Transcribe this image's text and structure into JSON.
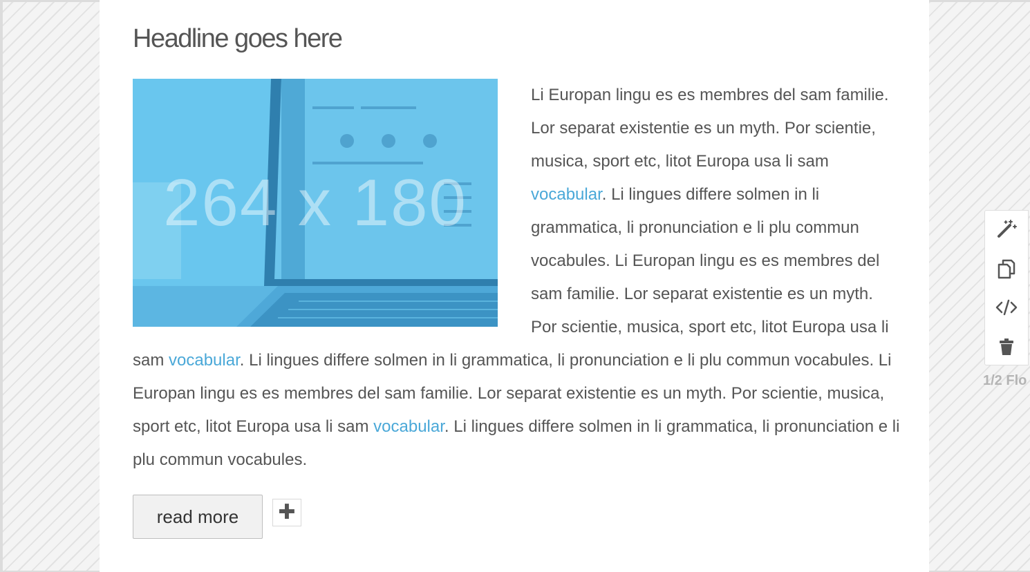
{
  "article": {
    "headline": "Headline goes here",
    "image": {
      "size_label": "264 x 180",
      "color": "#69c6ee"
    },
    "body": [
      {
        "text": "Li Europan lingu es es membres del sam familie. Lor separat existentie es un myth. Por scientie, musica, sport etc, litot Europa usa li sam "
      },
      {
        "link": "vocabular"
      },
      {
        "text": ". Li lingues differe solmen in li grammatica, li pronunciation e li plu commun vocabules. Li Europan lingu es es membres del sam familie. Lor separat existentie es un myth. Por scientie, musica, sport etc, litot Europa usa li sam "
      },
      {
        "link": "vocabular"
      },
      {
        "text": ". Li lingues differe solmen in li grammatica, li pronunciation e li plu commun vocabules. Li Europan lingu es es membres del sam familie. Lor separat existentie es un myth. Por scientie, musica, sport etc, litot Europa usa li sam "
      },
      {
        "link": "vocabular"
      },
      {
        "text": ". Li lingues differe solmen in li grammatica, li pronunciation e li plu commun vocabules."
      }
    ],
    "read_more_label": "read more",
    "add_label": "✚",
    "link_color": "#4aa8d8"
  },
  "toolbar": {
    "tools": [
      {
        "name": "magic-wand-icon"
      },
      {
        "name": "duplicate-icon"
      },
      {
        "name": "code-icon"
      },
      {
        "name": "trash-icon"
      }
    ]
  },
  "column_label": "1/2 Flo"
}
